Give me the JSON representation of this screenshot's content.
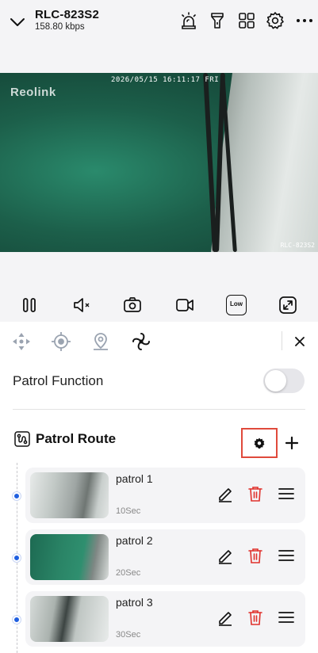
{
  "header": {
    "device_name": "RLC-823S2",
    "bitrate": "158.80 kbps",
    "icons": [
      "chevron-down-icon",
      "siren-icon",
      "spotlight-icon",
      "grid-icon",
      "gear-icon",
      "more-icon"
    ]
  },
  "video": {
    "timestamp": "2026/05/15 16:11:17 FRI",
    "brand": "Reolink",
    "camera_label": "RLC-823S2"
  },
  "toolbar": {
    "quality_label": "Low",
    "icons": [
      "pause-icon",
      "mute-icon",
      "snapshot-icon",
      "record-icon",
      "quality-icon",
      "fullscreen-icon"
    ]
  },
  "ptz": {
    "tabs": [
      "ptz-direction-icon",
      "preset-icon",
      "location-pin-icon",
      "patrol-icon"
    ],
    "active_tab": "patrol-icon",
    "patrol_function_label": "Patrol Function",
    "patrol_function_on": false,
    "route_title": "Patrol Route",
    "accent": "#1f5fe0",
    "delete_color": "#e0312c",
    "highlight_color": "#e04a3c",
    "patrols": [
      {
        "name": "patrol 1",
        "duration": "10Sec"
      },
      {
        "name": "patrol 2",
        "duration": "20Sec"
      },
      {
        "name": "patrol 3",
        "duration": "30Sec"
      }
    ]
  }
}
